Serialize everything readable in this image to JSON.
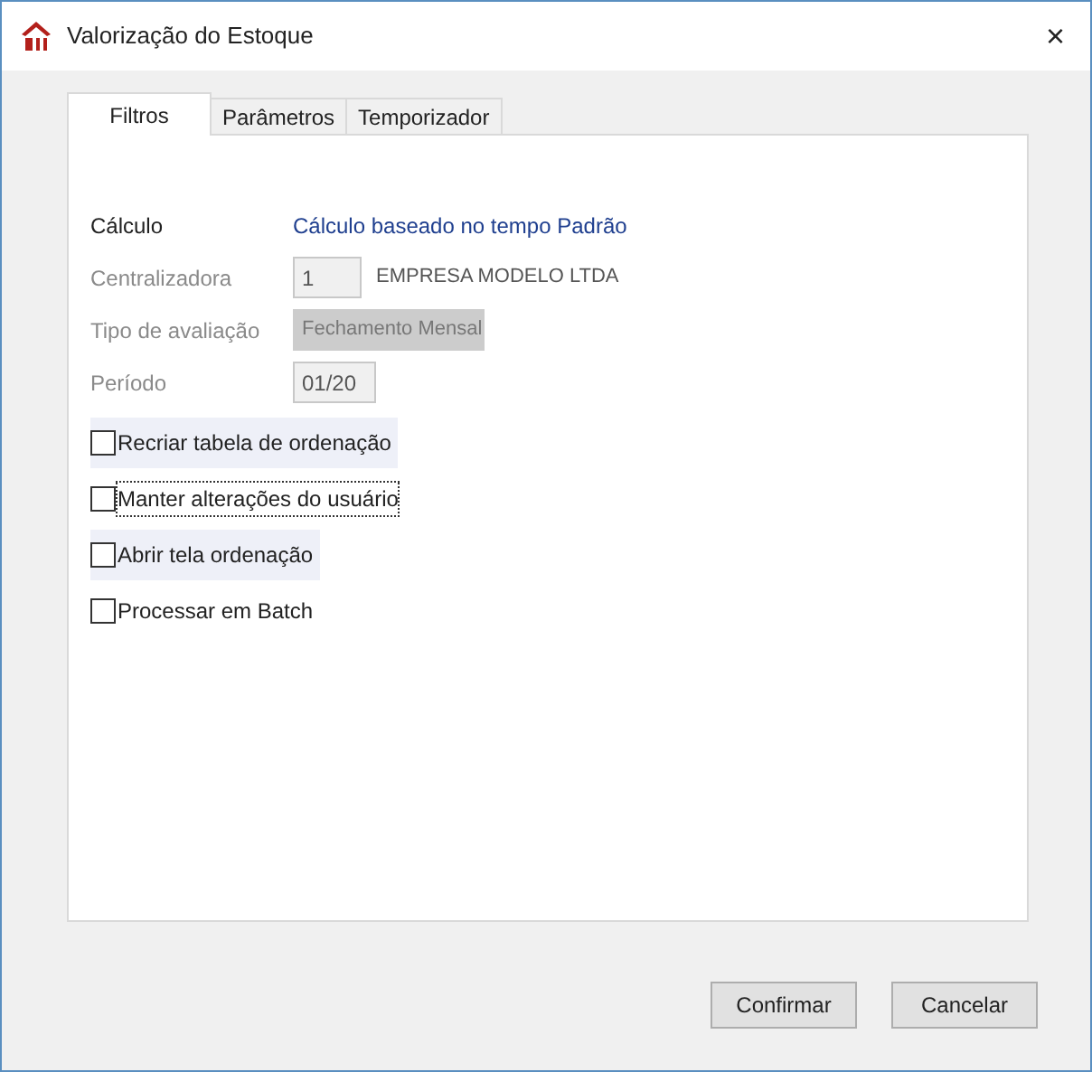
{
  "window": {
    "title": "Valorização do Estoque",
    "close": "×"
  },
  "tabs": [
    {
      "label": "Filtros",
      "selected": true
    },
    {
      "label": "Parâmetros",
      "selected": false
    },
    {
      "label": "Temporizador",
      "selected": false
    }
  ],
  "form": {
    "calculo": {
      "label": "Cálculo",
      "value": "Cálculo baseado no tempo Padrão"
    },
    "centralizadora": {
      "label": "Centralizadora",
      "value": "1",
      "description": "EMPRESA MODELO LTDA",
      "disabled": true
    },
    "tipo_avaliacao": {
      "label": "Tipo de avaliação",
      "value": "Fechamento Mensal",
      "disabled": true
    },
    "periodo": {
      "label": "Período",
      "value": "01/20",
      "disabled": true
    }
  },
  "checkboxes": [
    {
      "label": "Recriar tabela de ordenação",
      "checked": false,
      "highlighted": true,
      "focused": false
    },
    {
      "label": "Manter alterações do usuário",
      "checked": false,
      "highlighted": false,
      "focused": true
    },
    {
      "label": "Abrir tela ordenação",
      "checked": false,
      "highlighted": true,
      "focused": false
    },
    {
      "label": "Processar em Batch",
      "checked": false,
      "highlighted": false,
      "focused": false
    }
  ],
  "buttons": [
    {
      "label": "Confirmar"
    },
    {
      "label": "Cancelar"
    }
  ]
}
